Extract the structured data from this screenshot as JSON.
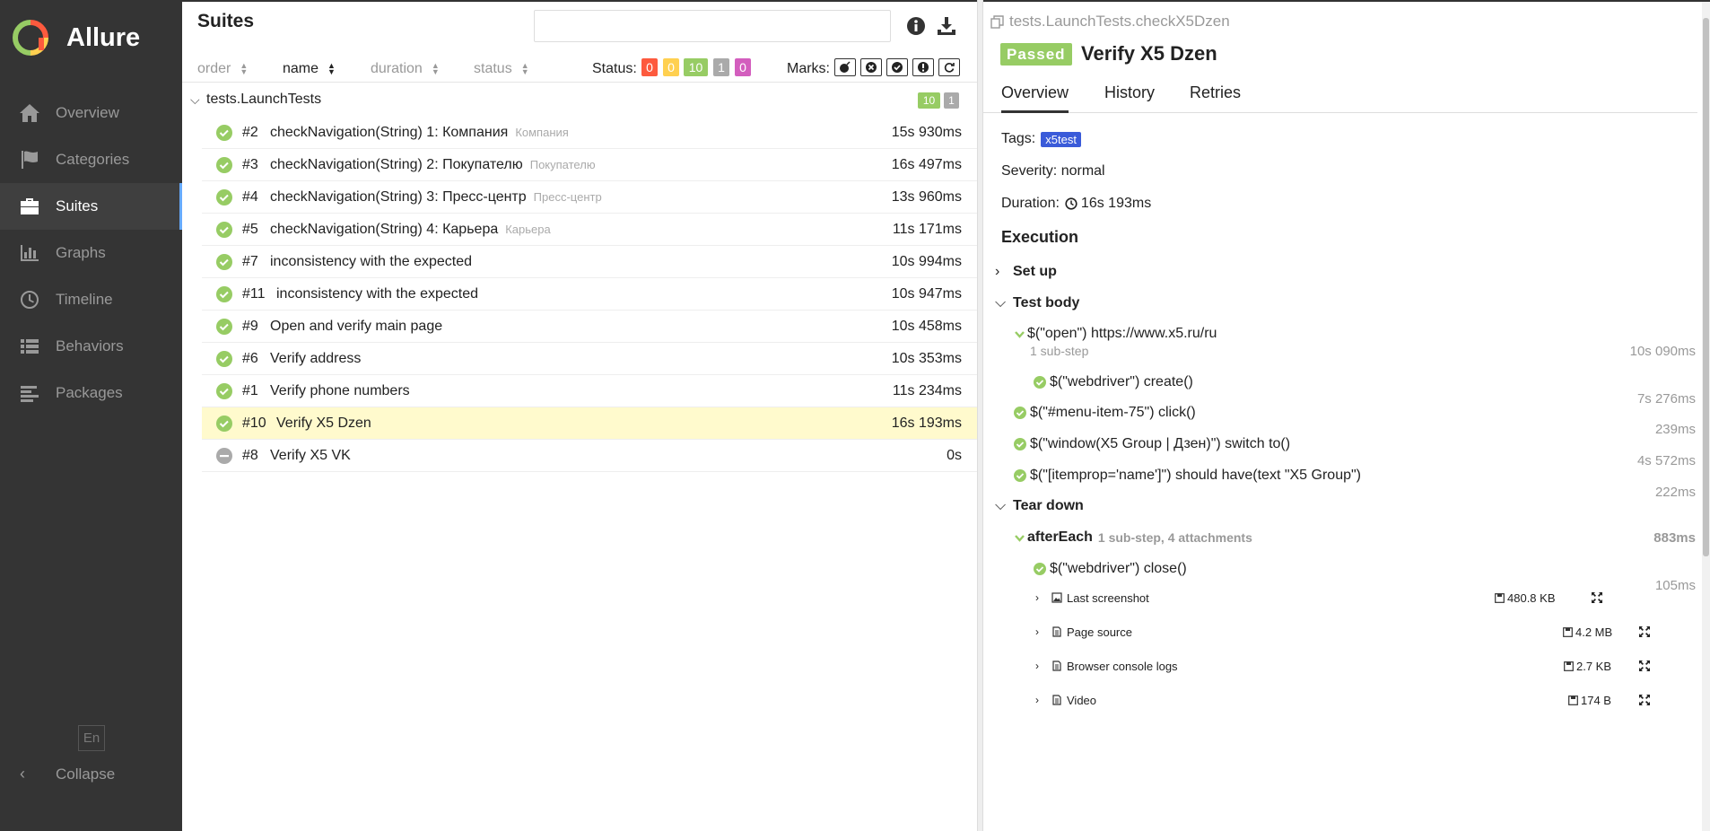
{
  "app": {
    "name": "Allure"
  },
  "sidebar": {
    "items": [
      {
        "label": "Overview",
        "icon": "home-icon"
      },
      {
        "label": "Categories",
        "icon": "flag-icon"
      },
      {
        "label": "Suites",
        "icon": "briefcase-icon",
        "active": true
      },
      {
        "label": "Graphs",
        "icon": "bar-chart-icon"
      },
      {
        "label": "Timeline",
        "icon": "clock-icon"
      },
      {
        "label": "Behaviors",
        "icon": "list-icon"
      },
      {
        "label": "Packages",
        "icon": "align-left-icon"
      }
    ],
    "language": "En",
    "collapse_label": "Collapse"
  },
  "suites": {
    "title": "Suites",
    "sort": {
      "order": "order",
      "name": "name",
      "duration": "duration",
      "status": "status"
    },
    "status_label": "Status:",
    "status_counts": [
      {
        "value": "0",
        "color": "#fd5a3e"
      },
      {
        "value": "0",
        "color": "#ffd050"
      },
      {
        "value": "10",
        "color": "#97cc64"
      },
      {
        "value": "1",
        "color": "#aaaaaa"
      },
      {
        "value": "0",
        "color": "#d35ebe"
      }
    ],
    "marks_label": "Marks:",
    "group": {
      "name": "tests.LaunchTests",
      "passed": "10",
      "skipped": "1"
    },
    "rows": [
      {
        "num": "#2",
        "name": "checkNavigation(String) 1: Компания",
        "sub": "Компания",
        "duration": "15s 930ms",
        "status": "passed"
      },
      {
        "num": "#3",
        "name": "checkNavigation(String) 2: Покупателю",
        "sub": "Покупателю",
        "duration": "16s 497ms",
        "status": "passed"
      },
      {
        "num": "#4",
        "name": "checkNavigation(String) 3: Пресс-центр",
        "sub": "Пресс-центр",
        "duration": "13s 960ms",
        "status": "passed"
      },
      {
        "num": "#5",
        "name": "checkNavigation(String) 4: Карьера",
        "sub": "Карьера",
        "duration": "11s 171ms",
        "status": "passed"
      },
      {
        "num": "#7",
        "name": "inconsistency with the expected",
        "sub": "",
        "duration": "10s 994ms",
        "status": "passed"
      },
      {
        "num": "#11",
        "name": "inconsistency with the expected",
        "sub": "",
        "duration": "10s 947ms",
        "status": "passed"
      },
      {
        "num": "#9",
        "name": "Open and verify main page",
        "sub": "",
        "duration": "10s 458ms",
        "status": "passed"
      },
      {
        "num": "#6",
        "name": "Verify address",
        "sub": "",
        "duration": "10s 353ms",
        "status": "passed"
      },
      {
        "num": "#1",
        "name": "Verify phone numbers",
        "sub": "",
        "duration": "11s 234ms",
        "status": "passed"
      },
      {
        "num": "#10",
        "name": "Verify X5 Dzen",
        "sub": "",
        "duration": "16s 193ms",
        "status": "passed",
        "selected": true
      },
      {
        "num": "#8",
        "name": "Verify X5 VK",
        "sub": "",
        "duration": "0s",
        "status": "skipped"
      }
    ]
  },
  "detail": {
    "path": "tests.LaunchTests.checkX5Dzen",
    "status": "Passed",
    "title": "Verify X5 Dzen",
    "tabs": [
      "Overview",
      "History",
      "Retries"
    ],
    "tags_label": "Tags:",
    "tag": "x5test",
    "severity": "Severity: normal",
    "duration_label": "Duration:",
    "duration": "16s 193ms",
    "execution_label": "Execution",
    "setup_label": "Set up",
    "testbody_label": "Test body",
    "teardown_label": "Tear down",
    "steps": {
      "open": "$(\"open\") https://www.x5.ru/ru",
      "open_note": "1 sub-step",
      "open_dur": "10s 090ms",
      "webdriver_create": "$(\"webdriver\") create()",
      "webdriver_create_dur": "7s 276ms",
      "menu_click": "$(\"#menu-item-75\") click()",
      "menu_click_dur": "239ms",
      "switch": "$(\"window(X5 Group | Дзен)\") switch to()",
      "switch_dur": "4s 572ms",
      "should": "$(\"[itemprop='name']\") should have(text \"X5 Group\")",
      "should_dur": "222ms",
      "after_each": "afterEach",
      "after_each_note": "1 sub-step, 4 attachments",
      "after_each_dur": "883ms",
      "close": "$(\"webdriver\") close()",
      "close_dur": "105ms"
    },
    "attachments": [
      {
        "name": "Last screenshot",
        "size": "480.8 KB",
        "icon": "image-file-icon"
      },
      {
        "name": "Page source",
        "size": "4.2 MB",
        "icon": "text-file-icon"
      },
      {
        "name": "Browser console logs",
        "size": "2.7 KB",
        "icon": "text-file-icon"
      },
      {
        "name": "Video",
        "size": "174 B",
        "icon": "text-file-icon"
      }
    ]
  }
}
